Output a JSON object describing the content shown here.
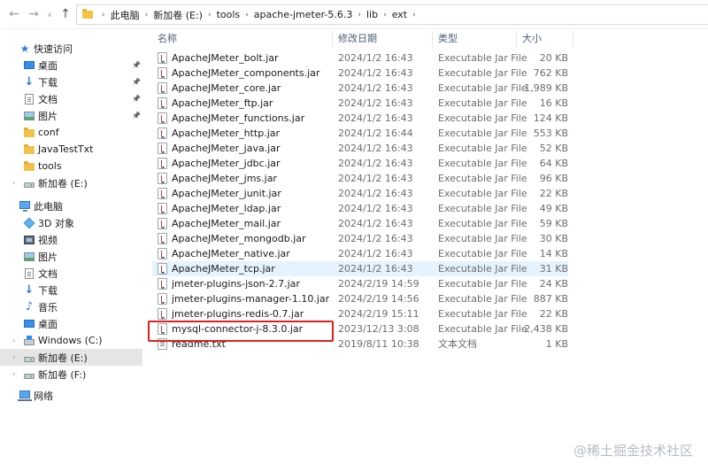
{
  "address_bar": {
    "breadcrumbs": [
      "此电脑",
      "新加卷 (E:)",
      "tools",
      "apache-jmeter-5.6.3",
      "lib",
      "ext"
    ]
  },
  "sidebar": {
    "quick_access": "快速访问",
    "quick_items": [
      {
        "label": "桌面",
        "icon": "desktop-icon"
      },
      {
        "label": "下载",
        "icon": "download-icon"
      },
      {
        "label": "文档",
        "icon": "document-icon"
      },
      {
        "label": "图片",
        "icon": "picture-icon"
      },
      {
        "label": "conf",
        "icon": "folder-icon"
      },
      {
        "label": "JavaTestTxt",
        "icon": "folder-icon"
      },
      {
        "label": "tools",
        "icon": "folder-icon"
      },
      {
        "label": "新加卷 (E:)",
        "icon": "drive-icon"
      }
    ],
    "this_pc": "此电脑",
    "pc_items": [
      {
        "label": "3D 对象",
        "icon": "3d-objects-icon"
      },
      {
        "label": "视频",
        "icon": "video-icon"
      },
      {
        "label": "图片",
        "icon": "picture-icon"
      },
      {
        "label": "文档",
        "icon": "document-icon"
      },
      {
        "label": "下载",
        "icon": "download-icon"
      },
      {
        "label": "音乐",
        "icon": "music-icon"
      },
      {
        "label": "桌面",
        "icon": "desktop-icon"
      },
      {
        "label": "Windows (C:)",
        "icon": "windows-drive-icon"
      },
      {
        "label": "新加卷 (E:)",
        "icon": "drive-icon"
      },
      {
        "label": "新加卷 (F:)",
        "icon": "drive-icon"
      }
    ],
    "network": "网络",
    "selected_item": "新加卷 (E:)"
  },
  "columns": {
    "name": "名称",
    "date": "修改日期",
    "type": "类型",
    "size": "大小"
  },
  "files": [
    {
      "name": "ApacheJMeter_bolt.jar",
      "date": "2024/1/2 16:43",
      "type": "Executable Jar File",
      "size": "20 KB"
    },
    {
      "name": "ApacheJMeter_components.jar",
      "date": "2024/1/2 16:43",
      "type": "Executable Jar File",
      "size": "762 KB"
    },
    {
      "name": "ApacheJMeter_core.jar",
      "date": "2024/1/2 16:43",
      "type": "Executable Jar File",
      "size": "1,989 KB"
    },
    {
      "name": "ApacheJMeter_ftp.jar",
      "date": "2024/1/2 16:43",
      "type": "Executable Jar File",
      "size": "16 KB"
    },
    {
      "name": "ApacheJMeter_functions.jar",
      "date": "2024/1/2 16:43",
      "type": "Executable Jar File",
      "size": "124 KB"
    },
    {
      "name": "ApacheJMeter_http.jar",
      "date": "2024/1/2 16:44",
      "type": "Executable Jar File",
      "size": "553 KB"
    },
    {
      "name": "ApacheJMeter_java.jar",
      "date": "2024/1/2 16:43",
      "type": "Executable Jar File",
      "size": "52 KB"
    },
    {
      "name": "ApacheJMeter_jdbc.jar",
      "date": "2024/1/2 16:43",
      "type": "Executable Jar File",
      "size": "64 KB"
    },
    {
      "name": "ApacheJMeter_jms.jar",
      "date": "2024/1/2 16:43",
      "type": "Executable Jar File",
      "size": "96 KB"
    },
    {
      "name": "ApacheJMeter_junit.jar",
      "date": "2024/1/2 16:43",
      "type": "Executable Jar File",
      "size": "22 KB"
    },
    {
      "name": "ApacheJMeter_ldap.jar",
      "date": "2024/1/2 16:43",
      "type": "Executable Jar File",
      "size": "49 KB"
    },
    {
      "name": "ApacheJMeter_mail.jar",
      "date": "2024/1/2 16:43",
      "type": "Executable Jar File",
      "size": "59 KB"
    },
    {
      "name": "ApacheJMeter_mongodb.jar",
      "date": "2024/1/2 16:43",
      "type": "Executable Jar File",
      "size": "30 KB"
    },
    {
      "name": "ApacheJMeter_native.jar",
      "date": "2024/1/2 16:43",
      "type": "Executable Jar File",
      "size": "14 KB"
    },
    {
      "name": "ApacheJMeter_tcp.jar",
      "date": "2024/1/2 16:43",
      "type": "Executable Jar File",
      "size": "31 KB"
    },
    {
      "name": "jmeter-plugins-json-2.7.jar",
      "date": "2024/2/19 14:59",
      "type": "Executable Jar File",
      "size": "24 KB"
    },
    {
      "name": "jmeter-plugins-manager-1.10.jar",
      "date": "2024/2/19 14:56",
      "type": "Executable Jar File",
      "size": "887 KB"
    },
    {
      "name": "jmeter-plugins-redis-0.7.jar",
      "date": "2024/2/19 15:11",
      "type": "Executable Jar File",
      "size": "22 KB"
    },
    {
      "name": "mysql-connector-j-8.3.0.jar",
      "date": "2023/12/13 3:08",
      "type": "Executable Jar File",
      "size": "2,438 KB"
    },
    {
      "name": "readme.txt",
      "date": "2019/8/11 10:38",
      "type": "文本文档",
      "size": "1 KB"
    }
  ],
  "hovered_file": "ApacheJMeter_tcp.jar",
  "highlighted_file": "mysql-connector-j-8.3.0.jar",
  "highlight_color": "#e0201b",
  "watermark": "@稀土掘金技术社区"
}
